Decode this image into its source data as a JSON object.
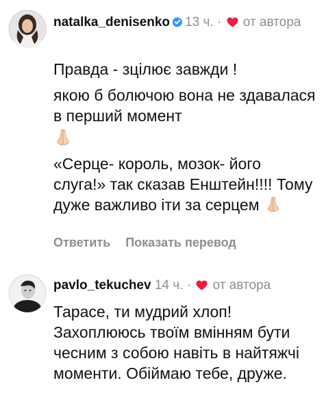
{
  "comments": [
    {
      "username": "natalka_denisenko",
      "verified": true,
      "time": "13 ч.",
      "dot": "·",
      "liked_by_author": "от автора",
      "paragraphs": [
        "Правда - зцілює завжди !",
        "якою б болючою вона не здавалася в перший момент",
        "«Серце- король, мозок- його слуга!» так сказав Енштейн!!!! Тому дуже важливо іти за серцем"
      ],
      "emoji_icon": "folded-hands-icon",
      "actions": {
        "reply": "Ответить",
        "translate": "Показать перевод"
      }
    },
    {
      "username": "pavlo_tekuchev",
      "verified": false,
      "time": "14 ч.",
      "dot": "·",
      "liked_by_author": "от автора",
      "paragraphs": [
        "Тарасе, ти мудрий хлоп! Захоплююсь твоїм вмінням бути чесним з собою навіть в найтяжчі моменти. Обіймаю тебе, друже."
      ]
    }
  ],
  "colors": {
    "heart": "#ed1c3c",
    "verified": "#3897f0",
    "secondary_text": "#8e8e8e"
  }
}
